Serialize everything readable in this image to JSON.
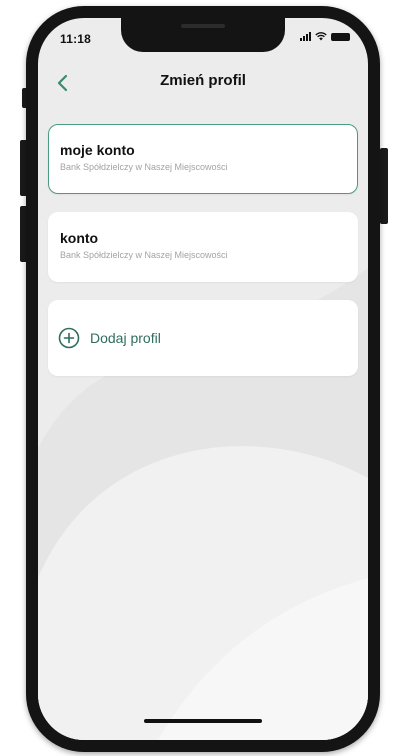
{
  "status_bar": {
    "time": "11:18",
    "icons": [
      "signal-icon",
      "wifi-icon",
      "battery-icon"
    ]
  },
  "header": {
    "title": "Zmień profil",
    "back_icon": "chevron-left-icon"
  },
  "profiles": [
    {
      "name": "moje konto",
      "bank": "Bank Spółdzielczy w Naszej Miejscowości",
      "selected": true
    },
    {
      "name": "konto",
      "bank": "Bank Spółdzielczy w Naszej Miejscowości",
      "selected": false
    }
  ],
  "add_profile": {
    "label": "Dodaj profil",
    "icon": "plus-circle-icon"
  },
  "colors": {
    "accent": "#2f6d5c",
    "selected_border": "#4a9b7f",
    "background": "#ececec",
    "card": "#ffffff",
    "frame": "#141414"
  }
}
